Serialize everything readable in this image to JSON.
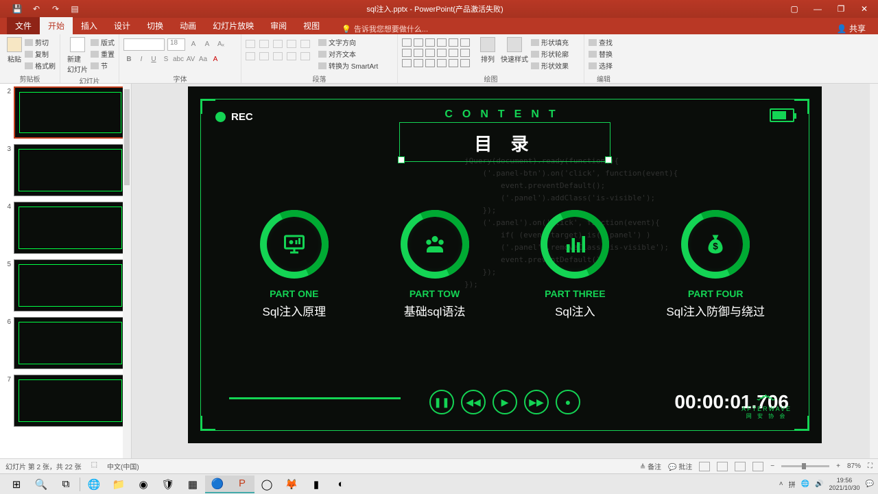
{
  "titlebar": {
    "title": "sql注入.pptx - PowerPoint(产品激活失败)"
  },
  "tabs": {
    "file": "文件",
    "home": "开始",
    "insert": "插入",
    "design": "设计",
    "transition": "切换",
    "animation": "动画",
    "slideshow": "幻灯片放映",
    "review": "审阅",
    "view": "视图",
    "tell_me": "告诉我您想要做什么...",
    "share": "共享"
  },
  "ribbon": {
    "clipboard": {
      "label": "剪贴板",
      "paste": "粘贴",
      "cut": "剪切",
      "copy": "复制",
      "format": "格式刷"
    },
    "slides": {
      "label": "幻灯片",
      "new": "新建\n幻灯片",
      "layout": "版式",
      "reset": "重置",
      "section": "节"
    },
    "font": {
      "label": "字体",
      "size": "18"
    },
    "paragraph": {
      "label": "段落",
      "textdir": "文字方向",
      "align": "对齐文本",
      "smartart": "转换为 SmartArt"
    },
    "drawing": {
      "label": "绘图",
      "arrange": "排列",
      "quick": "快速样式",
      "fill": "形状填充",
      "outline": "形状轮廓",
      "effects": "形状效果"
    },
    "editing": {
      "label": "编辑",
      "find": "查找",
      "replace": "替换",
      "select": "选择"
    }
  },
  "thumbs": [
    {
      "num": "2"
    },
    {
      "num": "3"
    },
    {
      "num": "4"
    },
    {
      "num": "5"
    },
    {
      "num": "6"
    },
    {
      "num": "7"
    }
  ],
  "slide": {
    "rec": "REC",
    "content": "CONTENT",
    "toc": "目 录",
    "parts": [
      {
        "label": "PART ONE",
        "desc": "Sql注入原理"
      },
      {
        "label": "PART TOW",
        "desc": "基础sql语法"
      },
      {
        "label": "PART THREE",
        "desc": "Sql注入"
      },
      {
        "label": "PART FOUR",
        "desc": "Sql注入防御与绕过"
      }
    ],
    "timecode": "00:00:01.706",
    "afterwave": "AFTERWAVE",
    "afterwave_sub": "网 安 协 会"
  },
  "status": {
    "slide": "幻灯片 第 2 张，共 22 张",
    "lang": "中文(中国)",
    "notes": "备注",
    "comments": "批注",
    "zoom": "87%"
  },
  "tray": {
    "ime": "拼",
    "time": "19:56",
    "date": "2021/10/30"
  }
}
